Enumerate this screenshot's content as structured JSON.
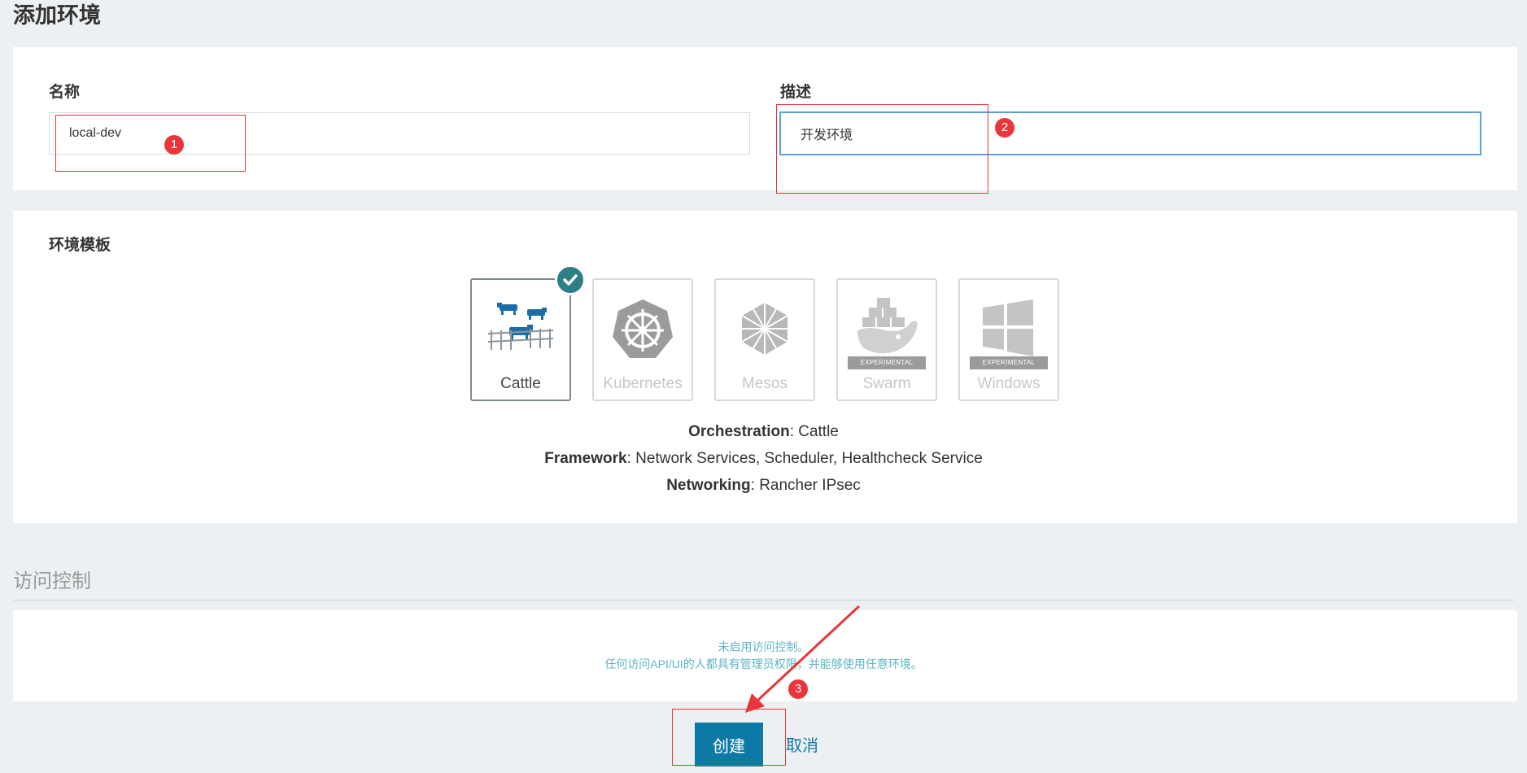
{
  "page": {
    "title": "添加环境"
  },
  "form": {
    "name_label": "名称",
    "name_value": "local-dev",
    "description_label": "描述",
    "description_value": "开发环境"
  },
  "templates": {
    "heading": "环境模板",
    "items": [
      {
        "name": "Cattle",
        "selected": true,
        "badge": ""
      },
      {
        "name": "Kubernetes",
        "selected": false,
        "badge": ""
      },
      {
        "name": "Mesos",
        "selected": false,
        "badge": ""
      },
      {
        "name": "Swarm",
        "selected": false,
        "badge": "EXPERIMENTAL"
      },
      {
        "name": "Windows",
        "selected": false,
        "badge": "EXPERIMENTAL"
      }
    ],
    "info": [
      {
        "key": "Orchestration",
        "value": ": Cattle"
      },
      {
        "key": "Framework",
        "value": ": Network Services, Scheduler, Healthcheck Service"
      },
      {
        "key": "Networking",
        "value": ": Rancher IPsec"
      }
    ]
  },
  "access_control": {
    "heading": "访问控制",
    "line1": "未启用访问控制。",
    "line2": "任何访问API/UI的人都具有管理员权限，并能够使用任意环境。"
  },
  "actions": {
    "create_label": "创建",
    "cancel_label": "取消"
  },
  "annotations": [
    "1",
    "2",
    "3"
  ],
  "colors": {
    "accent": "#0d7aa6",
    "selected_check": "#2d7f86",
    "annotation": "#e8363a",
    "notice": "#5fb5c8"
  }
}
